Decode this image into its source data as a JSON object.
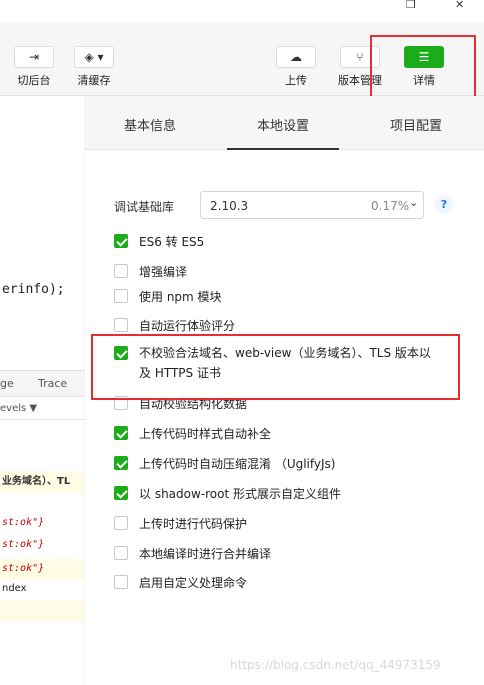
{
  "window": {
    "restore_glyph": "❐",
    "close_glyph": "✕"
  },
  "toolbar": {
    "switch_backend": {
      "icon": "⇥",
      "label": "切后台"
    },
    "clear_cache": {
      "icon": "◈ ▾",
      "label": "清缓存"
    },
    "upload": {
      "icon": "☁",
      "label": "上传"
    },
    "version_mgmt": {
      "icon": "⑂",
      "label": "版本管理"
    },
    "details": {
      "icon": "☰",
      "label": "详情"
    }
  },
  "editor": {
    "lines": [
      "erinfo);"
    ]
  },
  "console": {
    "tabs": [
      "ge",
      "Trace"
    ],
    "levels_label": "evels ▼",
    "rows": [
      {
        "text": "业务域名）、TL",
        "kind": "warn"
      },
      {
        "text": "st:ok\"}",
        "kind": "ok"
      },
      {
        "text": "st:ok\"}",
        "kind": "ok"
      },
      {
        "text": "st:ok\"}",
        "kind": "ok"
      },
      {
        "text": "ndex",
        "kind": "plain"
      }
    ]
  },
  "details": {
    "tabs": [
      "基本信息",
      "本地设置",
      "项目配置"
    ],
    "active_tab": "本地设置",
    "base_lib": {
      "label": "调试基础库",
      "version": "2.10.3",
      "percent": "0.17%",
      "chevron": "⌄",
      "help": "?"
    },
    "options": [
      {
        "label": "ES6 转 ES5",
        "checked": true
      },
      {
        "label": "增强编译",
        "checked": false
      },
      {
        "label": "使用 npm 模块",
        "checked": false
      },
      {
        "label": "自动运行体验评分",
        "checked": false
      },
      {
        "label": "不校验合法域名、web-view（业务域名）、TLS 版本以及 HTTPS 证书",
        "checked": true
      },
      {
        "label": "自动校验结构化数据",
        "checked": false
      },
      {
        "label": "上传代码时样式自动补全",
        "checked": true
      },
      {
        "label": "上传代码时自动压缩混淆 （UglifyJs)",
        "checked": true
      },
      {
        "label": "以 shadow-root 形式展示自定义组件",
        "checked": true
      },
      {
        "label": "上传时进行代码保护",
        "checked": false
      },
      {
        "label": "本地编译时进行合并编译",
        "checked": false
      },
      {
        "label": "启用自定义处理命令",
        "checked": false
      }
    ]
  },
  "watermark": "https://blog.csdn.net/qq_44973159",
  "colors": {
    "accent_green": "#1aad19",
    "highlight_red": "#e0312e"
  }
}
